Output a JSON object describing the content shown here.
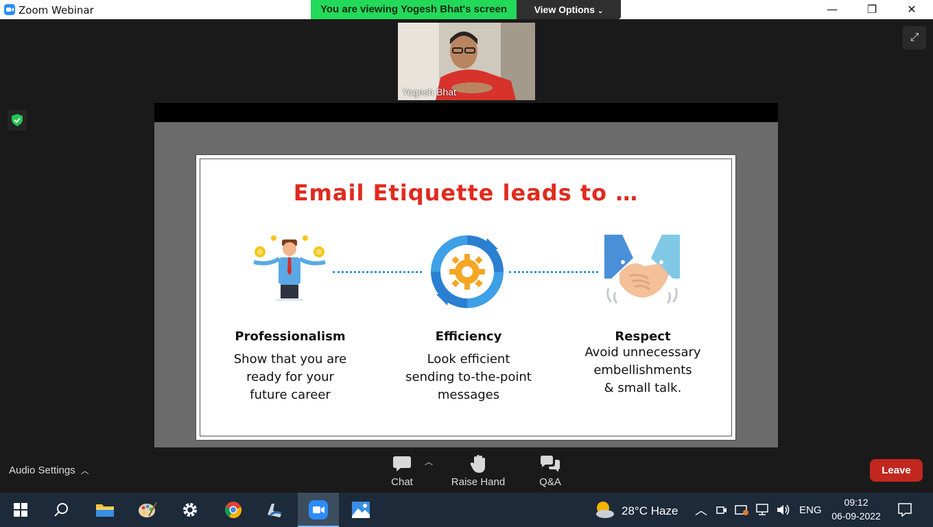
{
  "window": {
    "title": "Zoom Webinar",
    "viewing_banner": "You are viewing Yogesh Bhat's screen",
    "view_options": "View Options"
  },
  "video": {
    "participant_name": "Yogesh Bhat"
  },
  "slide": {
    "title": "Email Etiquette leads to …",
    "columns": [
      {
        "heading": "Professionalism",
        "lines": [
          "Show that you are",
          "ready for your",
          "future career"
        ],
        "icon": "juggling-man-icon"
      },
      {
        "heading": "Efficiency",
        "lines": [
          "Look efficient",
          "sending to-the-point",
          "messages"
        ],
        "icon": "gear-cycle-icon"
      },
      {
        "heading": "Respect",
        "lines": [
          "Avoid unnecessary",
          "embellishments",
          "& small talk."
        ],
        "icon": "handshake-icon"
      }
    ]
  },
  "toolbar": {
    "audio_settings": "Audio Settings",
    "chat": "Chat",
    "raise_hand": "Raise Hand",
    "qa": "Q&A",
    "leave": "Leave"
  },
  "taskbar": {
    "weather": "28°C  Haze",
    "language": "ENG",
    "time": "09:12",
    "date": "06-09-2022"
  },
  "colors": {
    "banner_green": "#23d959",
    "leave_red": "#c1271f",
    "slide_title_red": "#e02b1f",
    "accent_blue": "#2b98d6"
  }
}
